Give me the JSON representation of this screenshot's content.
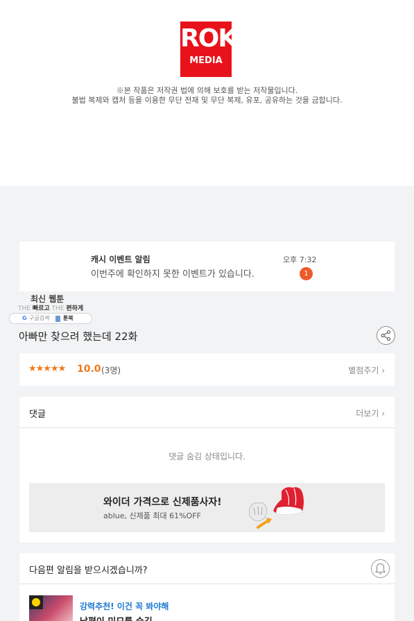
{
  "publisher": {
    "logo_top": "ROK",
    "logo_bottom": "MEDIA",
    "notice_line1": "※본 작품은 저작권 법에 의해 보호를 받는 저작물입니다.",
    "notice_line2": "불법 복제와 캡처 등을 이용한 무단 전재 및 무단 복제, 유포, 공유하는 것을 금합니다."
  },
  "alarm": {
    "title": "캐시 이벤트 알림",
    "message": "이번주에 확인하지 못한 이벤트가 있습니다.",
    "time": "오후 7:32",
    "badge_count": "1"
  },
  "site": {
    "name": "최신 웹툰",
    "slogan_the1": "THE",
    "slogan_fast": "빠르고",
    "slogan_the2": "THE",
    "slogan_easy": "편하게",
    "search_g": "G",
    "search_label": "구글검색",
    "book_label": "툰북"
  },
  "episode": {
    "title": "아빠만 찾으려 했는데 22화"
  },
  "rating": {
    "stars": "★★★★★",
    "score": "10.0",
    "count": "(3명)",
    "rate_label": "별점주기 ›"
  },
  "comments": {
    "label": "댓글",
    "more_label": "더보기 ›",
    "hidden_message": "댓글 숨김 상태입니다."
  },
  "ad": {
    "headline": "와이더 가격으로 신제품사자!",
    "sub": "ablue, 신제품 최대 61%OFF"
  },
  "next_notify": {
    "question": "다음편 알림을 받으시겠습니까?"
  },
  "recommend": {
    "tag": "강력추천! 이건 꼭 봐야해",
    "title": "남편이 미모를 숨김"
  },
  "colors": {
    "brand_red": "#e8121b",
    "accent_orange": "#f07a1a",
    "badge_orange": "#ec5a2b",
    "link_blue": "#1e78d2"
  }
}
